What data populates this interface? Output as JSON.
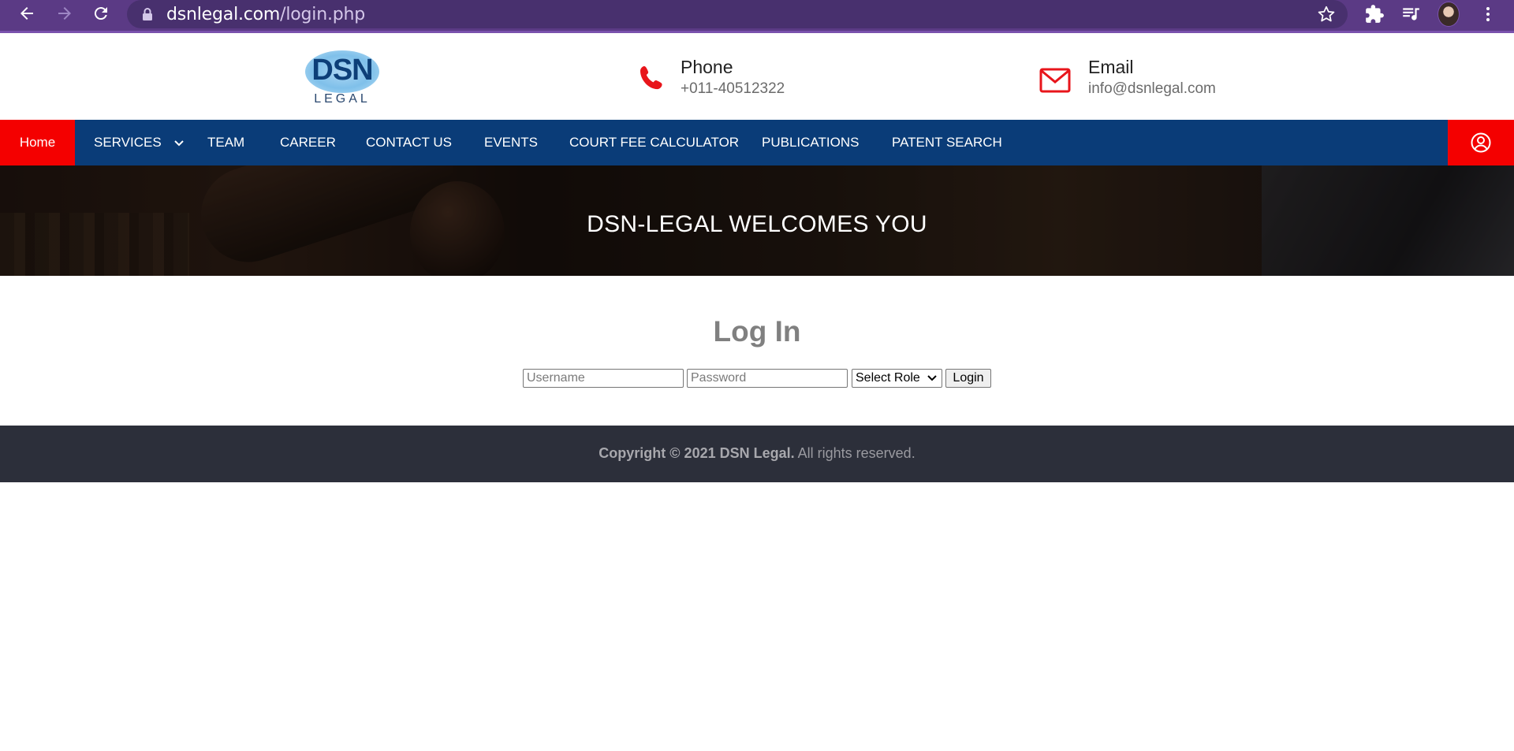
{
  "browser": {
    "url_host": "dsnlegal.com",
    "url_path": "/login.php"
  },
  "header": {
    "logo_main": "DSN",
    "logo_sub": "LEGAL",
    "phone_title": "Phone",
    "phone_value": "+011-40512322",
    "email_title": "Email",
    "email_value": "info@dsnlegal.com"
  },
  "nav": {
    "items": [
      "Home",
      "SERVICES",
      "TEAM",
      "CAREER",
      "CONTACT US",
      "EVENTS",
      "COURT FEE CALCULATOR",
      "PUBLICATIONS",
      "PATENT SEARCH"
    ]
  },
  "banner": {
    "title": "DSN-LEGAL WELCOMES YOU"
  },
  "login": {
    "title": "Log In",
    "username_placeholder": "Username",
    "password_placeholder": "Password",
    "role_select": "Select Role",
    "submit": "Login"
  },
  "footer": {
    "copyright_bold": "Copyright © 2021 DSN Legal.",
    "copyright_rest": "All rights reserved."
  },
  "colors": {
    "browser_frame": "#5b3a85",
    "nav_bg": "#0a3c78",
    "accent_red": "#f40000",
    "footer_bg": "#2c2f3a"
  }
}
